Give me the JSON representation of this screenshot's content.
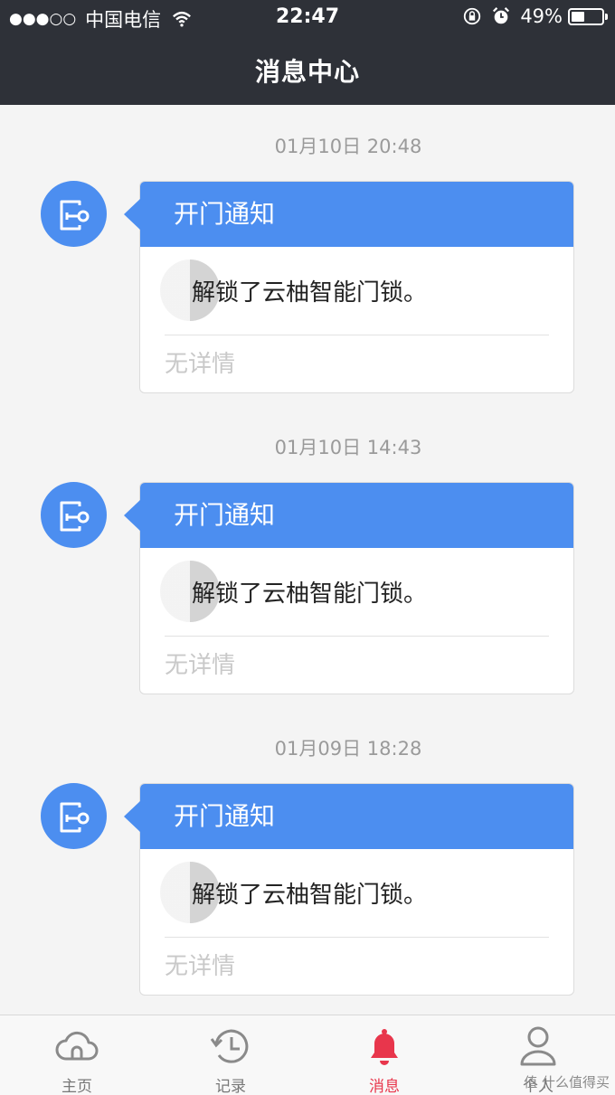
{
  "status_bar": {
    "signal": "●●●○○",
    "carrier": "中国电信",
    "time": "22:47",
    "battery_level": "49%"
  },
  "nav": {
    "title": "消息中心"
  },
  "messages": [
    {
      "time": "01月10日 20:48",
      "title": "开门通知",
      "text": "解锁了云柚智能门锁。",
      "detail": "无详情"
    },
    {
      "time": "01月10日 14:43",
      "title": "开门通知",
      "text": "解锁了云柚智能门锁。",
      "detail": "无详情"
    },
    {
      "time": "01月09日 18:28",
      "title": "开门通知",
      "text": "解锁了云柚智能门锁。",
      "detail": "无详情"
    }
  ],
  "tabs": [
    {
      "label": "主页",
      "icon": "cloud-icon"
    },
    {
      "label": "记录",
      "icon": "history-clock-icon"
    },
    {
      "label": "消息",
      "icon": "bell-icon",
      "active": true
    },
    {
      "label": "个人",
      "icon": "person-icon"
    }
  ],
  "watermark": "值 什么值得买",
  "colors": {
    "accent": "#4c8ef0",
    "tab_active": "#e8364c",
    "header_bg": "#2e3138"
  }
}
